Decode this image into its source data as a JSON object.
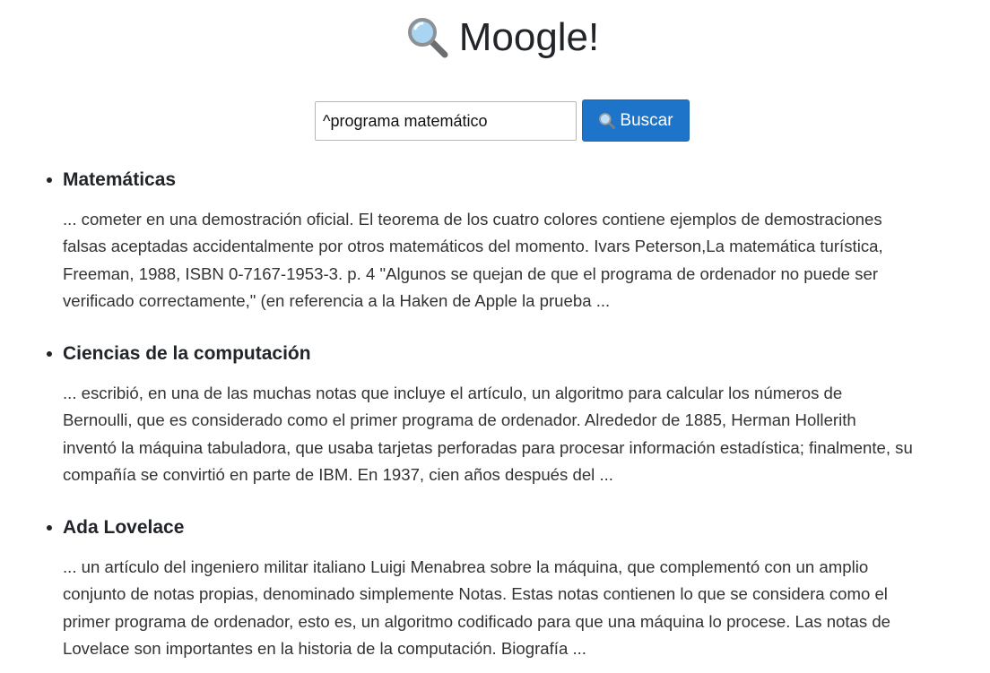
{
  "app": {
    "title": "Moogle!",
    "logo_icon": "magnifying-glass-icon"
  },
  "search": {
    "query": "^programa matemático",
    "button_label": "Buscar",
    "button_icon": "magnifying-glass-icon",
    "button_color": "#1e74c9"
  },
  "results": [
    {
      "title": "Matemáticas",
      "snippet_lines": [
        "... cometer en una demostración oficial. El teorema de los cuatro colores contiene ejemplos de demostraciones",
        "falsas aceptadas accidentalmente por otros matemáticos del momento. Ivars Peterson,La matemática turística,",
        "Freeman, 1988, ISBN 0-7167-1953-3. p. 4 \"Algunos se quejan de que el programa de ordenador no puede ser",
        "verificado correctamente,\" (en referencia a la Haken de Apple la prueba ..."
      ]
    },
    {
      "title": "Ciencias de la computación",
      "snippet_lines": [
        "... escribió, en una de las muchas notas que incluye el artículo, un algoritmo para calcular los números de",
        "Bernoulli, que es considerado como el primer programa de ordenador. Alrededor de 1885, Herman Hollerith",
        "inventó la máquina tabuladora, que usaba tarjetas perforadas para procesar información estadística; finalmente, su",
        "compañía se convirtió en parte de IBM. En 1937, cien años después del ..."
      ]
    },
    {
      "title": "Ada Lovelace",
      "snippet_lines": [
        "... un artículo del ingeniero militar italiano Luigi Menabrea sobre la máquina, que complementó con un amplio",
        "conjunto de notas propias, denominado simplemente Notas. Estas notas contienen lo que se considera como el",
        "primer programa de ordenador, esto es, un algoritmo codificado para que una máquina lo procese. Las notas de",
        "Lovelace son importantes en la historia de la computación. Biografía ..."
      ]
    }
  ]
}
